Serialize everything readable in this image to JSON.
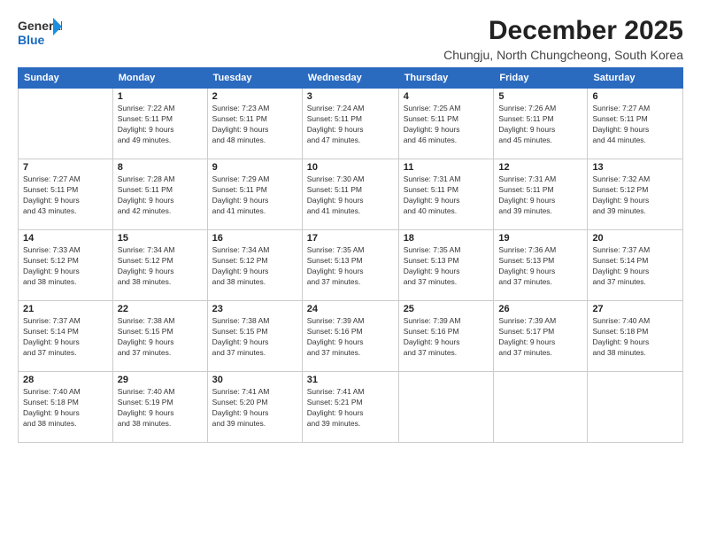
{
  "logo": {
    "line1": "General",
    "line2": "Blue"
  },
  "header": {
    "month": "December 2025",
    "location": "Chungju, North Chungcheong, South Korea"
  },
  "weekdays": [
    "Sunday",
    "Monday",
    "Tuesday",
    "Wednesday",
    "Thursday",
    "Friday",
    "Saturday"
  ],
  "weeks": [
    [
      {
        "day": "",
        "info": ""
      },
      {
        "day": "1",
        "info": "Sunrise: 7:22 AM\nSunset: 5:11 PM\nDaylight: 9 hours\nand 49 minutes."
      },
      {
        "day": "2",
        "info": "Sunrise: 7:23 AM\nSunset: 5:11 PM\nDaylight: 9 hours\nand 48 minutes."
      },
      {
        "day": "3",
        "info": "Sunrise: 7:24 AM\nSunset: 5:11 PM\nDaylight: 9 hours\nand 47 minutes."
      },
      {
        "day": "4",
        "info": "Sunrise: 7:25 AM\nSunset: 5:11 PM\nDaylight: 9 hours\nand 46 minutes."
      },
      {
        "day": "5",
        "info": "Sunrise: 7:26 AM\nSunset: 5:11 PM\nDaylight: 9 hours\nand 45 minutes."
      },
      {
        "day": "6",
        "info": "Sunrise: 7:27 AM\nSunset: 5:11 PM\nDaylight: 9 hours\nand 44 minutes."
      }
    ],
    [
      {
        "day": "7",
        "info": "Sunrise: 7:27 AM\nSunset: 5:11 PM\nDaylight: 9 hours\nand 43 minutes."
      },
      {
        "day": "8",
        "info": "Sunrise: 7:28 AM\nSunset: 5:11 PM\nDaylight: 9 hours\nand 42 minutes."
      },
      {
        "day": "9",
        "info": "Sunrise: 7:29 AM\nSunset: 5:11 PM\nDaylight: 9 hours\nand 41 minutes."
      },
      {
        "day": "10",
        "info": "Sunrise: 7:30 AM\nSunset: 5:11 PM\nDaylight: 9 hours\nand 41 minutes."
      },
      {
        "day": "11",
        "info": "Sunrise: 7:31 AM\nSunset: 5:11 PM\nDaylight: 9 hours\nand 40 minutes."
      },
      {
        "day": "12",
        "info": "Sunrise: 7:31 AM\nSunset: 5:11 PM\nDaylight: 9 hours\nand 39 minutes."
      },
      {
        "day": "13",
        "info": "Sunrise: 7:32 AM\nSunset: 5:12 PM\nDaylight: 9 hours\nand 39 minutes."
      }
    ],
    [
      {
        "day": "14",
        "info": "Sunrise: 7:33 AM\nSunset: 5:12 PM\nDaylight: 9 hours\nand 38 minutes."
      },
      {
        "day": "15",
        "info": "Sunrise: 7:34 AM\nSunset: 5:12 PM\nDaylight: 9 hours\nand 38 minutes."
      },
      {
        "day": "16",
        "info": "Sunrise: 7:34 AM\nSunset: 5:12 PM\nDaylight: 9 hours\nand 38 minutes."
      },
      {
        "day": "17",
        "info": "Sunrise: 7:35 AM\nSunset: 5:13 PM\nDaylight: 9 hours\nand 37 minutes."
      },
      {
        "day": "18",
        "info": "Sunrise: 7:35 AM\nSunset: 5:13 PM\nDaylight: 9 hours\nand 37 minutes."
      },
      {
        "day": "19",
        "info": "Sunrise: 7:36 AM\nSunset: 5:13 PM\nDaylight: 9 hours\nand 37 minutes."
      },
      {
        "day": "20",
        "info": "Sunrise: 7:37 AM\nSunset: 5:14 PM\nDaylight: 9 hours\nand 37 minutes."
      }
    ],
    [
      {
        "day": "21",
        "info": "Sunrise: 7:37 AM\nSunset: 5:14 PM\nDaylight: 9 hours\nand 37 minutes."
      },
      {
        "day": "22",
        "info": "Sunrise: 7:38 AM\nSunset: 5:15 PM\nDaylight: 9 hours\nand 37 minutes."
      },
      {
        "day": "23",
        "info": "Sunrise: 7:38 AM\nSunset: 5:15 PM\nDaylight: 9 hours\nand 37 minutes."
      },
      {
        "day": "24",
        "info": "Sunrise: 7:39 AM\nSunset: 5:16 PM\nDaylight: 9 hours\nand 37 minutes."
      },
      {
        "day": "25",
        "info": "Sunrise: 7:39 AM\nSunset: 5:16 PM\nDaylight: 9 hours\nand 37 minutes."
      },
      {
        "day": "26",
        "info": "Sunrise: 7:39 AM\nSunset: 5:17 PM\nDaylight: 9 hours\nand 37 minutes."
      },
      {
        "day": "27",
        "info": "Sunrise: 7:40 AM\nSunset: 5:18 PM\nDaylight: 9 hours\nand 38 minutes."
      }
    ],
    [
      {
        "day": "28",
        "info": "Sunrise: 7:40 AM\nSunset: 5:18 PM\nDaylight: 9 hours\nand 38 minutes."
      },
      {
        "day": "29",
        "info": "Sunrise: 7:40 AM\nSunset: 5:19 PM\nDaylight: 9 hours\nand 38 minutes."
      },
      {
        "day": "30",
        "info": "Sunrise: 7:41 AM\nSunset: 5:20 PM\nDaylight: 9 hours\nand 39 minutes."
      },
      {
        "day": "31",
        "info": "Sunrise: 7:41 AM\nSunset: 5:21 PM\nDaylight: 9 hours\nand 39 minutes."
      },
      {
        "day": "",
        "info": ""
      },
      {
        "day": "",
        "info": ""
      },
      {
        "day": "",
        "info": ""
      }
    ]
  ]
}
